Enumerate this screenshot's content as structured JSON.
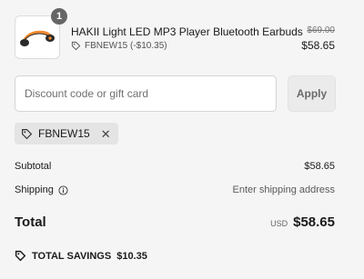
{
  "product": {
    "quantity": "1",
    "title": "HAKII Light LED MP3 Player Bluetooth Earbuds",
    "discount_line": "FBNEW15 (-$10.35)",
    "price_original": "$69.00",
    "price_final": "$58.65",
    "image_icon": "earbuds-image"
  },
  "discount": {
    "placeholder": "Discount code or gift card",
    "value": "",
    "apply_label": "Apply"
  },
  "applied_code": {
    "code": "FBNEW15",
    "icon": "tag-icon",
    "remove_icon": "close-icon"
  },
  "summary": {
    "subtotal_label": "Subtotal",
    "subtotal_value": "$58.65",
    "shipping_label": "Shipping",
    "shipping_value": "Enter shipping address",
    "total_label": "Total",
    "total_currency": "USD",
    "total_value": "$58.65",
    "savings_label": "TOTAL SAVINGS",
    "savings_value": "$10.35"
  },
  "colors": {
    "background": "#f5f5f5",
    "badge": "#666666",
    "chip": "#e4e4e4",
    "earbud_orange": "#f28a2e"
  }
}
